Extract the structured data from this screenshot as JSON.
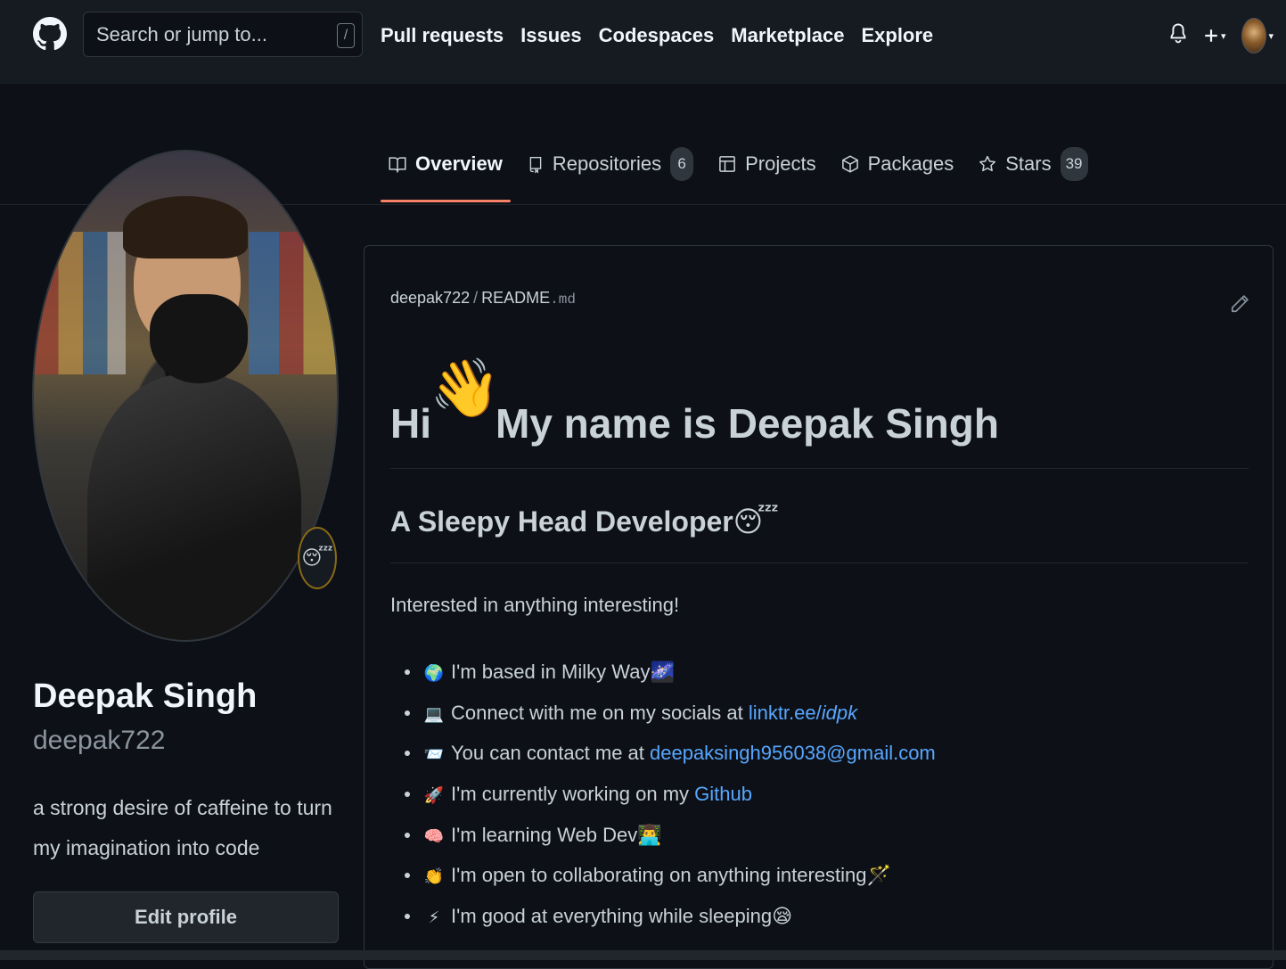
{
  "header": {
    "search_placeholder": "Search or jump to...",
    "search_shortcut": "/",
    "nav": [
      "Pull requests",
      "Issues",
      "Codespaces",
      "Marketplace",
      "Explore"
    ],
    "icons": [
      "github-logo-icon",
      "bell-icon",
      "plus-icon",
      "avatar"
    ]
  },
  "tabs": [
    {
      "label": "Overview",
      "icon": "book-icon",
      "selected": true
    },
    {
      "label": "Repositories",
      "icon": "repo-icon",
      "count": "6"
    },
    {
      "label": "Projects",
      "icon": "table-icon"
    },
    {
      "label": "Packages",
      "icon": "package-icon"
    },
    {
      "label": "Stars",
      "icon": "star-icon",
      "count": "39"
    }
  ],
  "profile": {
    "name": "Deepak Singh",
    "login": "deepak722",
    "bio": "a strong desire of caffeine to turn my imagination into code",
    "status_emoji": "😴",
    "edit_button": "Edit profile"
  },
  "readme": {
    "owner": "deepak722",
    "separator": "/",
    "file": "README",
    "ext": ".md",
    "greeting": "Hi",
    "wave_emoji": "👋",
    "heading": "My name is Deepak Singh",
    "subheading": "A Sleepy Head Developer",
    "subheading_emoji": "😴",
    "intro": "Interested in anything interesting!",
    "items": [
      {
        "icon": "🌍",
        "text": "I'm based in Milky Way",
        "trail": "🌌"
      },
      {
        "icon": "💻",
        "text": "Connect with me on my socials at ",
        "link1": "linktr.ee/",
        "link2": "idpk"
      },
      {
        "icon": "📨",
        "text": "You can contact me at ",
        "link1": "deepaksingh956038@gmail.com"
      },
      {
        "icon": "🚀",
        "text": "I'm currently working on my ",
        "link1": "Github"
      },
      {
        "icon": "🧠",
        "text": "I'm learning Web Dev",
        "trail": "👨‍💻"
      },
      {
        "icon": "👏",
        "text": "I'm open to collaborating on anything interesting",
        "trail": "🪄"
      },
      {
        "icon": "⚡",
        "text": "I'm good at everything while sleeping",
        "trail": "😪"
      }
    ]
  }
}
